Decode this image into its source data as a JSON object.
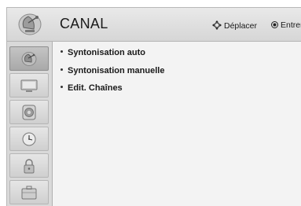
{
  "header": {
    "title": "CANAL",
    "icon": "satellite-dish-icon",
    "hints": [
      {
        "icon": "four-way-arrow-icon",
        "label": "Déplacer"
      },
      {
        "icon": "ok-dot-icon",
        "label": "Entrer"
      }
    ]
  },
  "sidebar": {
    "items": [
      {
        "icon": "satellite-dish-icon",
        "active": true
      },
      {
        "icon": "tv-screen-icon",
        "active": false
      },
      {
        "icon": "speaker-icon",
        "active": false
      },
      {
        "icon": "clock-icon",
        "active": false
      },
      {
        "icon": "lock-icon",
        "active": false
      },
      {
        "icon": "briefcase-icon",
        "active": false
      }
    ]
  },
  "menu": {
    "items": [
      {
        "label": "Syntonisation auto"
      },
      {
        "label": "Syntonisation manuelle"
      },
      {
        "label": "Edit. Chaînes"
      }
    ]
  }
}
